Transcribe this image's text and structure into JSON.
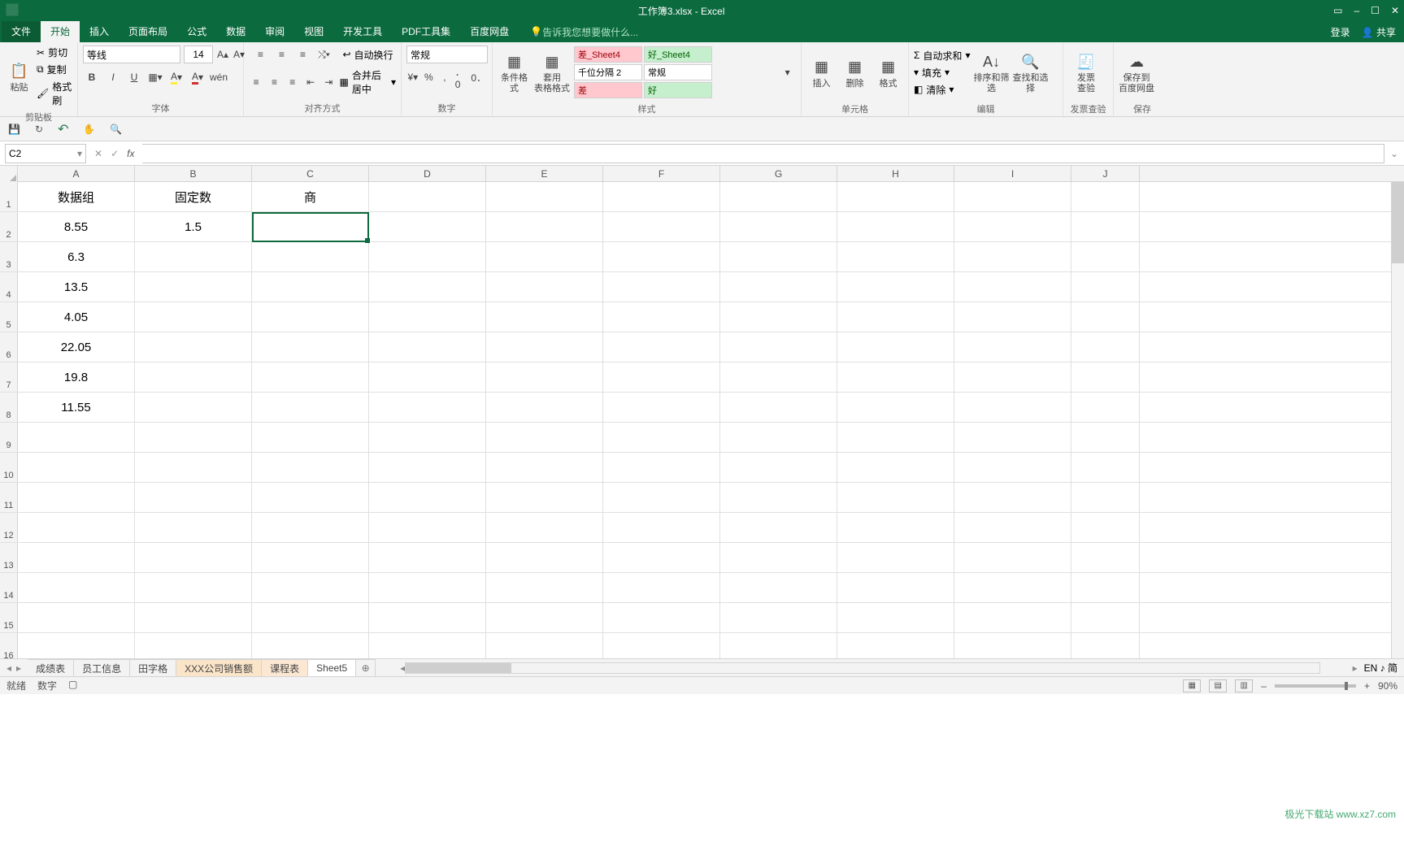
{
  "title": "工作簿3.xlsx - Excel",
  "win_buttons": {
    "settings": "⚙",
    "up": "▢",
    "min": "–",
    "max": "☐",
    "close": "✕"
  },
  "tabs": {
    "file": "文件",
    "home": "开始",
    "insert": "插入",
    "layout": "页面布局",
    "formula": "公式",
    "data": "数据",
    "review": "审阅",
    "view": "视图",
    "dev": "开发工具",
    "pdf": "PDF工具集",
    "baidu": "百度网盘"
  },
  "tellme": "告诉我您想要做什么...",
  "login": "登录",
  "share": "共享",
  "clipboard": {
    "paste": "粘贴",
    "cut": "剪切",
    "copy": "复制",
    "painter": "格式刷",
    "label": "剪贴板"
  },
  "font": {
    "name": "等线",
    "size": "14",
    "label": "字体",
    "bold": "B",
    "italic": "I",
    "underline": "U"
  },
  "align": {
    "wrap": "自动换行",
    "merge": "合并后居中",
    "label": "对齐方式"
  },
  "number": {
    "format": "常规",
    "label": "数字"
  },
  "styles": {
    "cond": "条件格式",
    "table": "套用\n表格格式",
    "bad": "差_Sheet4",
    "good": "好_Sheet4",
    "sep": "千位分隔 2",
    "normal": "常规",
    "bad2": "差",
    "good2": "好",
    "label": "样式"
  },
  "cells": {
    "insert": "插入",
    "delete": "删除",
    "format": "格式",
    "label": "单元格"
  },
  "editing": {
    "sum": "自动求和",
    "fill": "填充",
    "clear": "清除",
    "sort": "排序和筛选",
    "find": "查找和选择",
    "label": "编辑"
  },
  "invoice": {
    "btn": "发票\n查验",
    "label": "发票查验"
  },
  "save": {
    "btn": "保存到\n百度网盘",
    "label": "保存"
  },
  "qat": {
    "save": "💾",
    "redo": "↻",
    "undo": "↶",
    "touch": "✋",
    "preview": "🔍"
  },
  "namebox": "C2",
  "formula": "",
  "cols": [
    "A",
    "B",
    "C",
    "D",
    "E",
    "F",
    "G",
    "H",
    "I",
    "J"
  ],
  "rows": [
    {
      "n": "1",
      "A": "数据组",
      "B": "固定数",
      "C": "商"
    },
    {
      "n": "2",
      "A": "8.55",
      "B": "1.5",
      "C": ""
    },
    {
      "n": "3",
      "A": "6.3"
    },
    {
      "n": "4",
      "A": "13.5"
    },
    {
      "n": "5",
      "A": "4.05"
    },
    {
      "n": "6",
      "A": "22.05"
    },
    {
      "n": "7",
      "A": "19.8"
    },
    {
      "n": "8",
      "A": "11.55"
    },
    {
      "n": "9"
    },
    {
      "n": "10"
    },
    {
      "n": "11"
    },
    {
      "n": "12"
    },
    {
      "n": "13"
    },
    {
      "n": "14"
    },
    {
      "n": "15"
    },
    {
      "n": "16"
    }
  ],
  "sheets": {
    "s1": "成绩表",
    "s2": "员工信息",
    "s3": "田字格",
    "s4": "XXX公司销售额",
    "s5": "课程表",
    "s6": "Sheet5",
    "add": "⊕"
  },
  "status": {
    "ready": "就绪",
    "digit": "数字",
    "ime": "EN ♪ 简",
    "zoom": "90%",
    "minus": "–",
    "plus": "+"
  },
  "watermark": "极光下载站  www.xz7.com"
}
